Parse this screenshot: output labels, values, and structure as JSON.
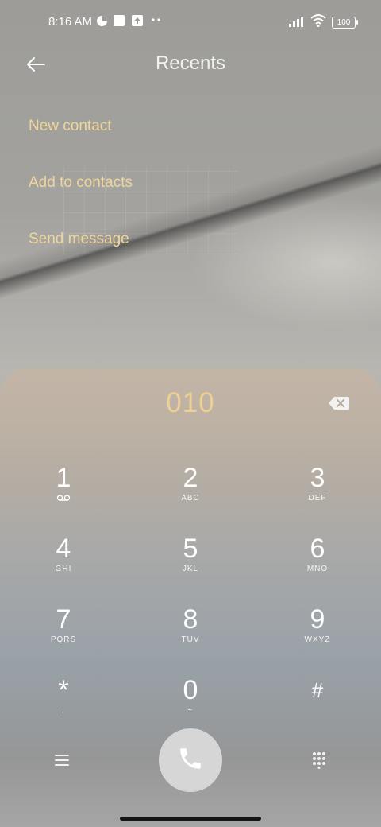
{
  "status_bar": {
    "time": "8:16 AM",
    "battery": "100",
    "icons": [
      "notification-icon",
      "square-icon",
      "upload-icon",
      "more-dots-icon",
      "signal-icon",
      "wifi-icon",
      "battery-icon"
    ]
  },
  "header": {
    "title": "Recents",
    "back_icon": "back-arrow-icon"
  },
  "menu": {
    "new_contact": "New contact",
    "add_to_contacts": "Add to contacts",
    "send_message": "Send message"
  },
  "dialer": {
    "entered_number": "010",
    "keys": [
      {
        "digit": "1",
        "letters": "",
        "icon": "voicemail-icon"
      },
      {
        "digit": "2",
        "letters": "ABC"
      },
      {
        "digit": "3",
        "letters": "DEF"
      },
      {
        "digit": "4",
        "letters": "GHI"
      },
      {
        "digit": "5",
        "letters": "JKL"
      },
      {
        "digit": "6",
        "letters": "MNO"
      },
      {
        "digit": "7",
        "letters": "PQRS"
      },
      {
        "digit": "8",
        "letters": "TUV"
      },
      {
        "digit": "9",
        "letters": "WXYZ"
      },
      {
        "digit": "*",
        "letters": ","
      },
      {
        "digit": "0",
        "letters": "+"
      },
      {
        "digit": "#",
        "letters": ""
      }
    ]
  },
  "colors": {
    "accent": "#f0d59a",
    "number": "#ecd095",
    "call_button": "#d6d6d6"
  }
}
